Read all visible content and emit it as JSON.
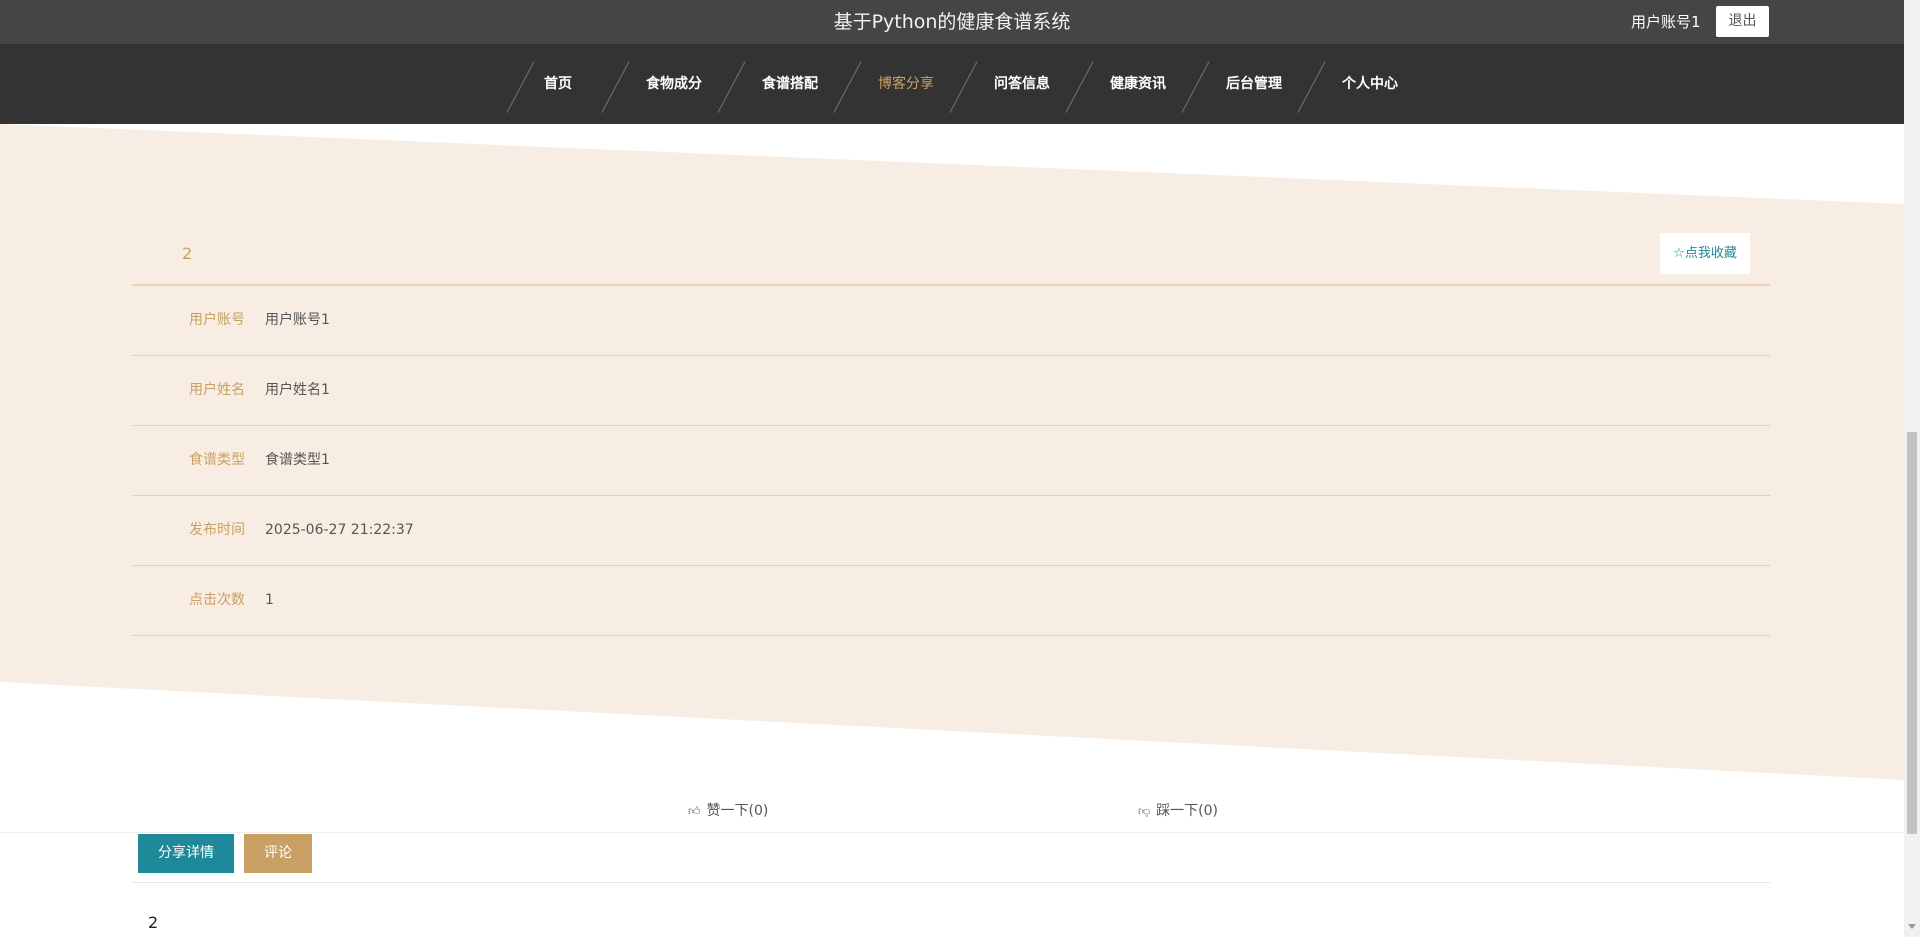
{
  "header": {
    "site_title": "基于Python的健康食谱系统",
    "user_name": "用户账号1",
    "logout_label": "退出"
  },
  "nav": {
    "items": [
      {
        "label": "首页",
        "active": false
      },
      {
        "label": "食物成分",
        "active": false
      },
      {
        "label": "食谱搭配",
        "active": false
      },
      {
        "label": "博客分享",
        "active": true
      },
      {
        "label": "问答信息",
        "active": false
      },
      {
        "label": "健康资讯",
        "active": false
      },
      {
        "label": "后台管理",
        "active": false
      },
      {
        "label": "个人中心",
        "active": false
      }
    ]
  },
  "detail": {
    "title": "2",
    "favorite_label": "☆点我收藏",
    "fields": [
      {
        "label": "用户账号",
        "value": "用户账号1"
      },
      {
        "label": "用户姓名",
        "value": "用户姓名1"
      },
      {
        "label": "食谱类型",
        "value": "食谱类型1"
      },
      {
        "label": "发布时间",
        "value": "2025-06-27 21:22:37"
      },
      {
        "label": "点击次数",
        "value": "1"
      }
    ]
  },
  "actions": {
    "like_label": "赞一下(0)",
    "dislike_label": "踩一下(0)"
  },
  "tabs": {
    "share_detail_label": "分享详情",
    "comment_label": "评论"
  },
  "content": {
    "text": "2"
  },
  "colors": {
    "accent_gold": "#c9a063",
    "accent_teal": "#1e8a99",
    "band_bg": "#f8ede3",
    "nav_bg": "#333333",
    "topbar_bg": "#454545"
  }
}
